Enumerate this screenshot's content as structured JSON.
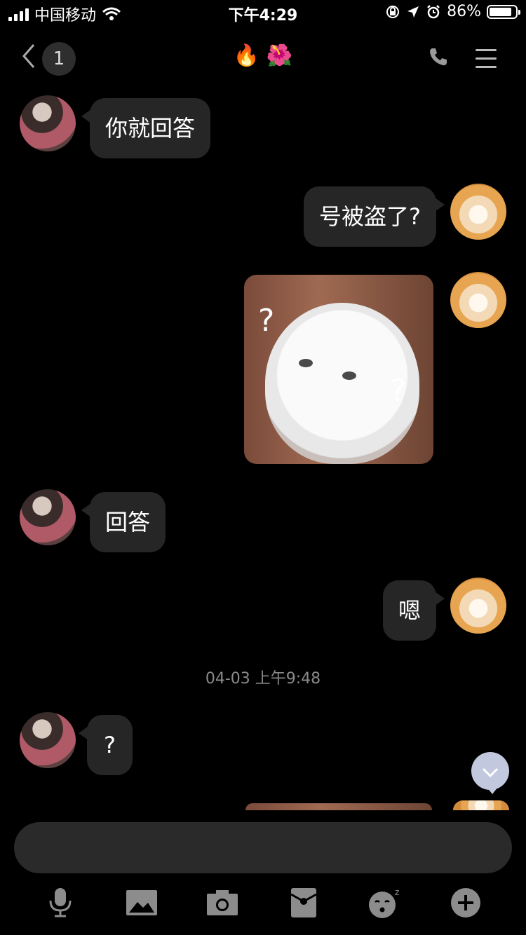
{
  "status_bar": {
    "carrier": "中国移动",
    "time": "下午4:29",
    "battery_percent": "86%",
    "battery_level": 0.86
  },
  "nav": {
    "unread_count": "1",
    "title": "🔥 🌺"
  },
  "messages": [
    {
      "side": "left",
      "type": "text",
      "text": "你就回答"
    },
    {
      "side": "right",
      "type": "text",
      "text": "号被盗了?"
    },
    {
      "side": "right",
      "type": "image",
      "overlay_marks": [
        "?",
        "?"
      ]
    },
    {
      "side": "left",
      "type": "text",
      "text": "回答"
    },
    {
      "side": "right",
      "type": "text",
      "text": "嗯"
    },
    {
      "side": "left",
      "type": "text",
      "text": "?"
    }
  ],
  "timestamp": "04-03 上午9:48",
  "icons": {
    "toolbar": [
      "microphone-icon",
      "image-icon",
      "camera-icon",
      "red-packet-icon",
      "sticker-icon",
      "plus-icon"
    ],
    "nav": [
      "back-icon",
      "phone-icon",
      "menu-icon"
    ]
  },
  "colors": {
    "background": "#000000",
    "bubble": "#262626",
    "scroll_button": "#c2c9df"
  }
}
